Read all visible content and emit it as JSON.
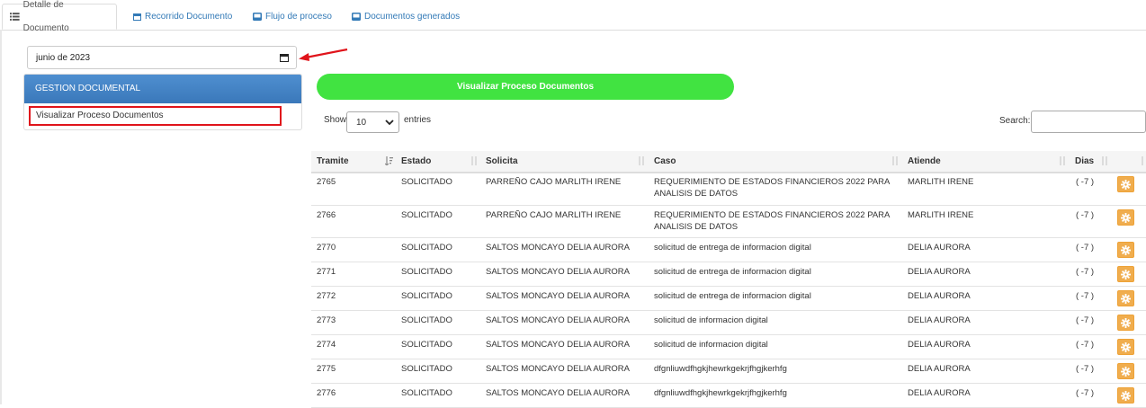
{
  "tabs": [
    {
      "label": "Detalle de Documento",
      "icon": "list-icon",
      "active": true
    },
    {
      "label": "Recorrido Documento",
      "icon": "calendar-icon",
      "active": false
    },
    {
      "label": "Flujo de proceso",
      "icon": "drive-icon",
      "active": false
    },
    {
      "label": "Documentos generados",
      "icon": "drive-icon",
      "active": false
    }
  ],
  "date_input": {
    "value": "junio de 2023",
    "icon": "calendar-icon"
  },
  "menu": {
    "header": "GESTION DOCUMENTAL",
    "items": [
      {
        "label": "Visualizar Proceso Documentos"
      }
    ]
  },
  "visualize_button": "Visualizar Proceso Documentos",
  "table_controls": {
    "show_label": "Show",
    "page_size": "10",
    "entries_label": "entries",
    "search_label": "Search:"
  },
  "table": {
    "columns": [
      "Tramite",
      "Estado",
      "Solicita",
      "Caso",
      "Atiende",
      "Dias"
    ],
    "rows": [
      {
        "tramite": "2765",
        "estado": "SOLICITADO",
        "solicita": "PARREÑO CAJO MARLITH IRENE",
        "caso": [
          "REQUERIMIENTO DE ESTADOS FINANCIEROS 2022 PARA",
          "ANALISIS DE DATOS"
        ],
        "atiende": "MARLITH IRENE",
        "dias": "( -7 )"
      },
      {
        "tramite": "2766",
        "estado": "SOLICITADO",
        "solicita": "PARREÑO CAJO MARLITH IRENE",
        "caso": [
          "REQUERIMIENTO DE ESTADOS FINANCIEROS 2022 PARA",
          "ANALISIS DE DATOS"
        ],
        "atiende": "MARLITH IRENE",
        "dias": "( -7 )"
      },
      {
        "tramite": "2770",
        "estado": "SOLICITADO",
        "solicita": "SALTOS MONCAYO DELIA AURORA",
        "caso": [
          "solicitud de entrega de informacion digital"
        ],
        "atiende": "DELIA AURORA",
        "dias": "( -7 )"
      },
      {
        "tramite": "2771",
        "estado": "SOLICITADO",
        "solicita": "SALTOS MONCAYO DELIA AURORA",
        "caso": [
          "solicitud de entrega de informacion digital"
        ],
        "atiende": "DELIA AURORA",
        "dias": "( -7 )"
      },
      {
        "tramite": "2772",
        "estado": "SOLICITADO",
        "solicita": "SALTOS MONCAYO DELIA AURORA",
        "caso": [
          "solicitud de entrega de informacion digital"
        ],
        "atiende": "DELIA AURORA",
        "dias": "( -7 )"
      },
      {
        "tramite": "2773",
        "estado": "SOLICITADO",
        "solicita": "SALTOS MONCAYO DELIA AURORA",
        "caso": [
          "solicitud de informacion digital"
        ],
        "atiende": "DELIA AURORA",
        "dias": "( -7 )"
      },
      {
        "tramite": "2774",
        "estado": "SOLICITADO",
        "solicita": "SALTOS MONCAYO DELIA AURORA",
        "caso": [
          "solicitud de informacion digital"
        ],
        "atiende": "DELIA AURORA",
        "dias": "( -7 )"
      },
      {
        "tramite": "2775",
        "estado": "SOLICITADO",
        "solicita": "SALTOS MONCAYO DELIA AURORA",
        "caso": [
          "dfgnliuwdfhgkjhewrkgekrjfhgjkerhfg"
        ],
        "atiende": "DELIA AURORA",
        "dias": "( -7 )"
      },
      {
        "tramite": "2776",
        "estado": "SOLICITADO",
        "solicita": "SALTOS MONCAYO DELIA AURORA",
        "caso": [
          "dfgnliuwdfhgkjhewrkgekrjfhgjkerhfg"
        ],
        "atiende": "DELIA AURORA",
        "dias": "( -7 )"
      }
    ],
    "action_icon": "gear-icon"
  },
  "colors": {
    "accent_green": "#41e341",
    "header_blue": "#3a78ba",
    "highlight_red": "#e0141b",
    "gear_orange": "#f0ad4e",
    "link_blue": "#337ab7"
  }
}
